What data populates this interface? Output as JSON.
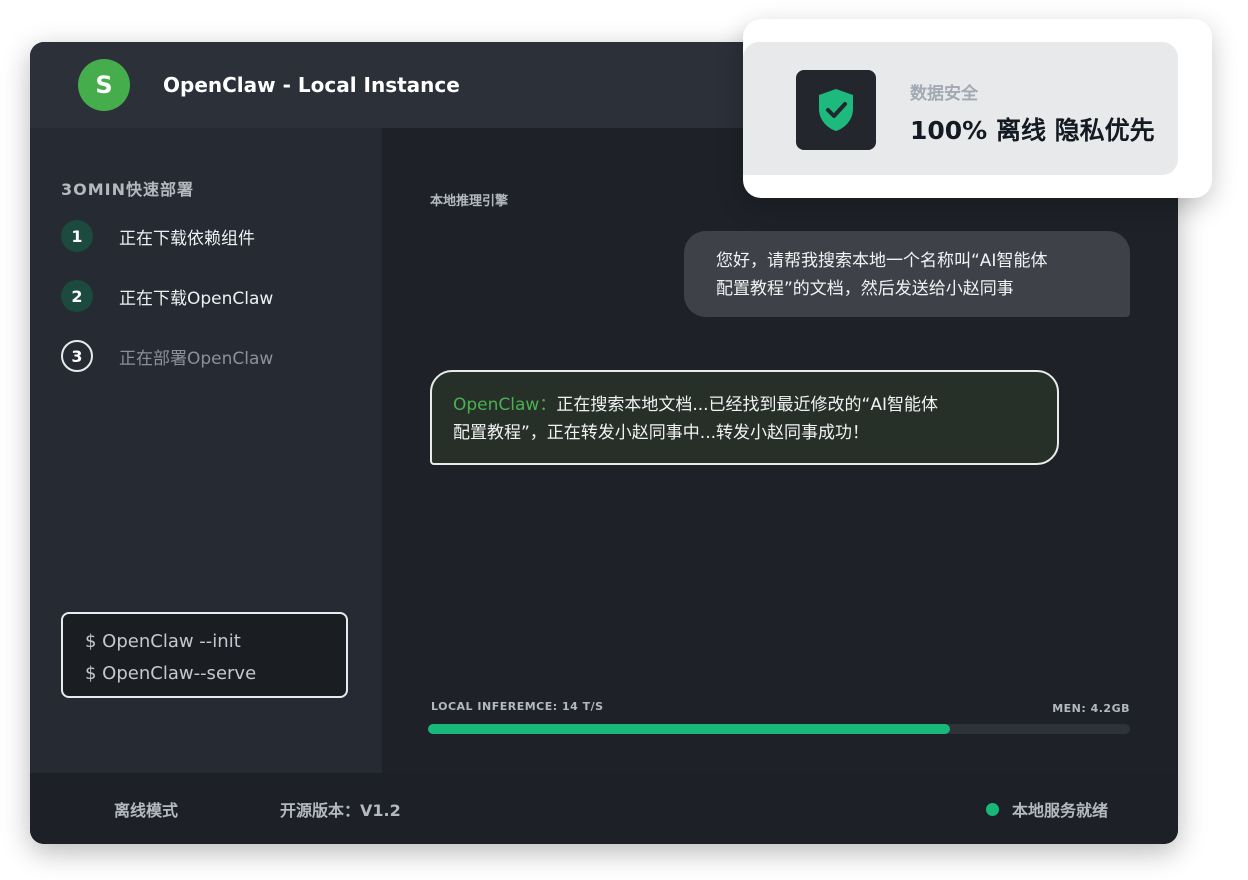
{
  "app": {
    "avatar_letter": "S",
    "title": "OpenClaw - Local Instance"
  },
  "sidebar": {
    "heading": "3OMIN快速部署",
    "steps": [
      {
        "number": "1",
        "label": "正在下载依赖组件",
        "state": "done"
      },
      {
        "number": "2",
        "label": "正在下载OpenClaw",
        "state": "done"
      },
      {
        "number": "3",
        "label": "正在部署OpenClaw",
        "state": "pending"
      }
    ],
    "terminal": [
      "$ OpenClaw --init",
      "$ OpenClaw--serve"
    ]
  },
  "main": {
    "engine_label": "本地推理引擎",
    "user_message_line1": "您好，请帮我搜索本地一个名称叫“AI智能体",
    "user_message_line2": "配置教程”的文档，然后发送给小赵同事",
    "bot_name": "OpenClaw：",
    "bot_message_line1": "正在搜索本地文档...已经找到最近修改的“AI智能体",
    "bot_message_line2": "配置教程”，正在转发小赵同事中...转发小赵同事成功！",
    "stat_left": "LOCAL INFEREMCE: 14 T/S",
    "stat_right": "MEN: 4.2GB",
    "progress_fraction": 0.743
  },
  "footer": {
    "mode": "离线模式",
    "version": "开源版本：V1.2",
    "status": "本地服务就绪"
  },
  "security": {
    "icon": "shield-check-icon",
    "title": "数据安全",
    "headline": "100% 离线 隐私优先"
  },
  "colors": {
    "accent_green": "#19b77a",
    "avatar_green": "#45ad4b",
    "bot_name_green": "#4caf50"
  }
}
